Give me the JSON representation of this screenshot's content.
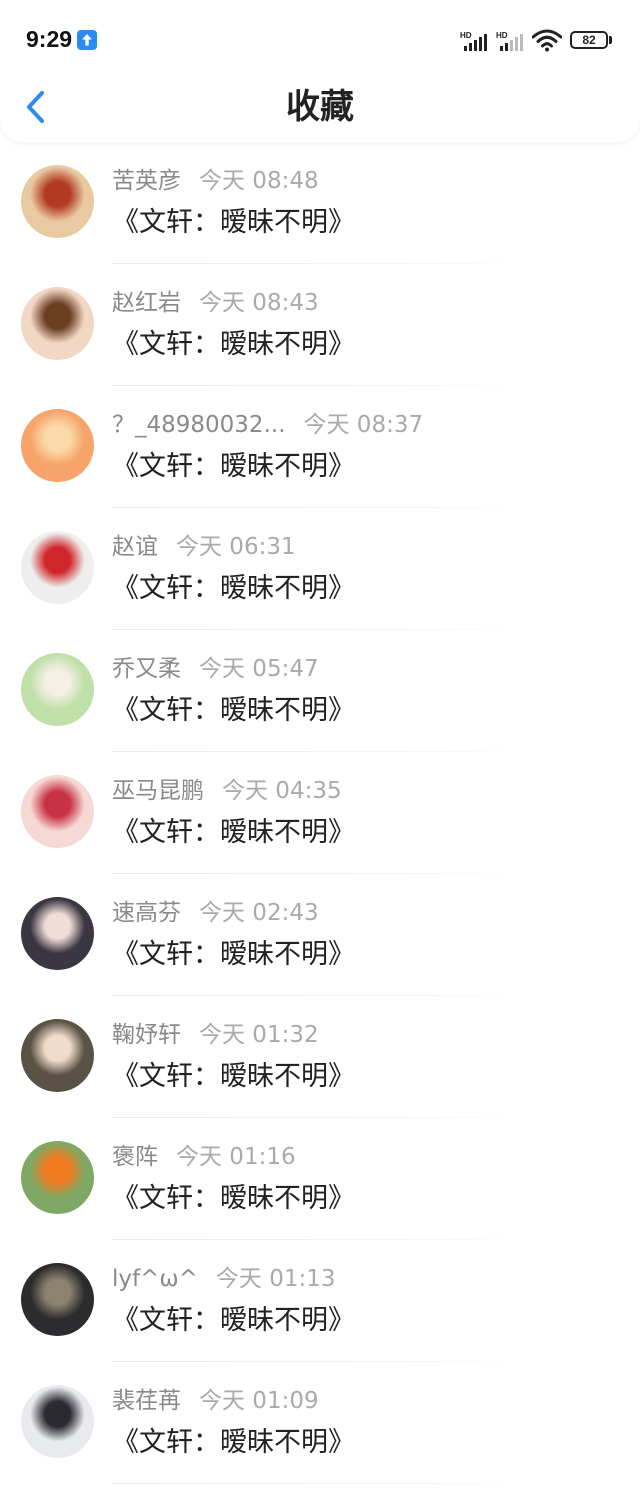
{
  "status_bar": {
    "time": "9:29",
    "network_1": "HD",
    "network_2": "HD",
    "battery": "82",
    "upload_icon": "upload-arrow-icon"
  },
  "header": {
    "title": "收藏",
    "back_icon": "chevron-left-icon"
  },
  "items": [
    {
      "name": "苦英彦",
      "time": "今天 08:48",
      "message": "《文轩：暧昧不明》",
      "avatar_color": "#e9c9a2",
      "avatar_accent": "#b33a22"
    },
    {
      "name": "赵红岩",
      "time": "今天 08:43",
      "message": "《文轩：暧昧不明》",
      "avatar_color": "#f1d7c4",
      "avatar_accent": "#6b3e22"
    },
    {
      "name": "？_48980032...",
      "time": "今天 08:37",
      "message": "《文轩：暧昧不明》",
      "avatar_color": "#f7a46a",
      "avatar_accent": "#fcd9a8"
    },
    {
      "name": "赵谊",
      "time": "今天 06:31",
      "message": "《文轩：暧昧不明》",
      "avatar_color": "#eeeeee",
      "avatar_accent": "#d0262a"
    },
    {
      "name": "乔又柔",
      "time": "今天 05:47",
      "message": "《文轩：暧昧不明》",
      "avatar_color": "#bfe0a8",
      "avatar_accent": "#f4f0e4"
    },
    {
      "name": "巫马昆鹏",
      "time": "今天 04:35",
      "message": "《文轩：暧昧不明》",
      "avatar_color": "#f6d8d4",
      "avatar_accent": "#c83246"
    },
    {
      "name": "速高芬",
      "time": "今天 02:43",
      "message": "《文轩：暧昧不明》",
      "avatar_color": "#3a3642",
      "avatar_accent": "#f0dcd8"
    },
    {
      "name": "鞠妤轩",
      "time": "今天 01:32",
      "message": "《文轩：暧昧不明》",
      "avatar_color": "#5a5244",
      "avatar_accent": "#f1dccb"
    },
    {
      "name": "褒阵",
      "time": "今天 01:16",
      "message": "《文轩：暧昧不明》",
      "avatar_color": "#7fa864",
      "avatar_accent": "#f07a20"
    },
    {
      "name": "lyf^ω^",
      "time": "今天 01:13",
      "message": "《文轩：暧昧不明》",
      "avatar_color": "#2c2c2e",
      "avatar_accent": "#8c8270"
    },
    {
      "name": "裴荏苒",
      "time": "今天 01:09",
      "message": "《文轩：暧昧不明》",
      "avatar_color": "#e8eaee",
      "avatar_accent": "#2a2a30"
    }
  ]
}
